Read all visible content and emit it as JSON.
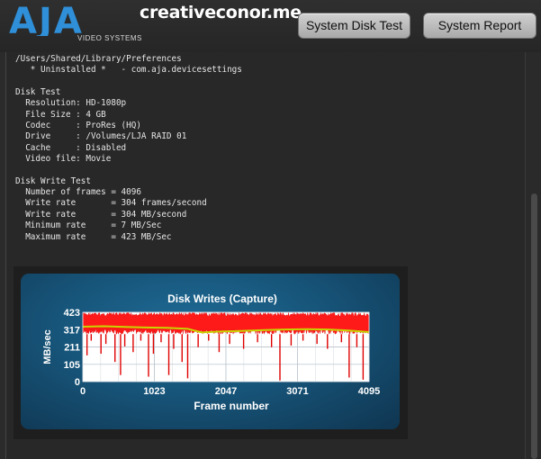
{
  "header": {
    "logo_text": "AJA",
    "logo_subtext": "VIDEO SYSTEMS",
    "watermark": "creativeconor.me",
    "buttons": {
      "system_disk_test": "System Disk Test",
      "system_report": "System Report"
    }
  },
  "report_lines": [
    "/Users/Shared/Library/Preferences",
    "   * Uninstalled *   - com.aja.devicesettings",
    "",
    "Disk Test",
    "  Resolution: HD-1080p",
    "  File Size : 4 GB",
    "  Codec     : ProRes (HQ)",
    "  Drive     : /Volumes/LJA RAID 01",
    "  Cache     : Disabled",
    "  Video file: Movie",
    "",
    "Disk Write Test",
    "  Number of frames = 4096",
    "  Write rate       = 304 frames/second",
    "  Write rate       = 304 MB/second",
    "  Minimum rate     = 7 MB/Sec",
    "  Maximum rate     = 423 MB/Sec"
  ],
  "colors": {
    "rate_fill": "#ff1a1a",
    "average_line": "#c8d400",
    "panel_blue": "#17557a"
  },
  "chart_data": {
    "type": "area",
    "title": "Disk Writes (Capture)",
    "xlabel": "Frame number",
    "ylabel": "MB/sec",
    "xlim": [
      0,
      4095
    ],
    "ylim": [
      0,
      423
    ],
    "x_ticks": [
      "0",
      "1023",
      "2047",
      "3071",
      "4095"
    ],
    "y_ticks": [
      "423",
      "317",
      "211",
      "105",
      "0"
    ],
    "grid": true,
    "series": [
      {
        "kind": "write_rate",
        "band_min": 290,
        "band_max": 423,
        "dips": [
          {
            "x": 60,
            "y": 160
          },
          {
            "x": 120,
            "y": 250
          },
          {
            "x": 260,
            "y": 170
          },
          {
            "x": 330,
            "y": 230
          },
          {
            "x": 460,
            "y": 120
          },
          {
            "x": 540,
            "y": 40
          },
          {
            "x": 600,
            "y": 215
          },
          {
            "x": 720,
            "y": 180
          },
          {
            "x": 830,
            "y": 250
          },
          {
            "x": 940,
            "y": 30
          },
          {
            "x": 1010,
            "y": 170
          },
          {
            "x": 1120,
            "y": 240
          },
          {
            "x": 1230,
            "y": 40
          },
          {
            "x": 1300,
            "y": 200
          },
          {
            "x": 1420,
            "y": 120
          },
          {
            "x": 1500,
            "y": 20
          },
          {
            "x": 1650,
            "y": 210
          },
          {
            "x": 1800,
            "y": 250
          },
          {
            "x": 1950,
            "y": 180
          },
          {
            "x": 2100,
            "y": 230
          },
          {
            "x": 2300,
            "y": 200
          },
          {
            "x": 2500,
            "y": 240
          },
          {
            "x": 2700,
            "y": 210
          },
          {
            "x": 2820,
            "y": 7
          },
          {
            "x": 2980,
            "y": 220
          },
          {
            "x": 3150,
            "y": 250
          },
          {
            "x": 3350,
            "y": 230
          },
          {
            "x": 3500,
            "y": 200
          },
          {
            "x": 3700,
            "y": 240
          },
          {
            "x": 3810,
            "y": 25
          },
          {
            "x": 3920,
            "y": 210
          },
          {
            "x": 4010,
            "y": 12
          }
        ]
      },
      {
        "kind": "average",
        "x": [
          0,
          300,
          600,
          900,
          1200,
          1500,
          1700,
          2000,
          2300,
          2600,
          2900,
          3200,
          3500,
          3800,
          4095
        ],
        "y": [
          335,
          338,
          334,
          330,
          328,
          322,
          300,
          306,
          310,
          314,
          318,
          320,
          318,
          312,
          302
        ]
      }
    ]
  }
}
